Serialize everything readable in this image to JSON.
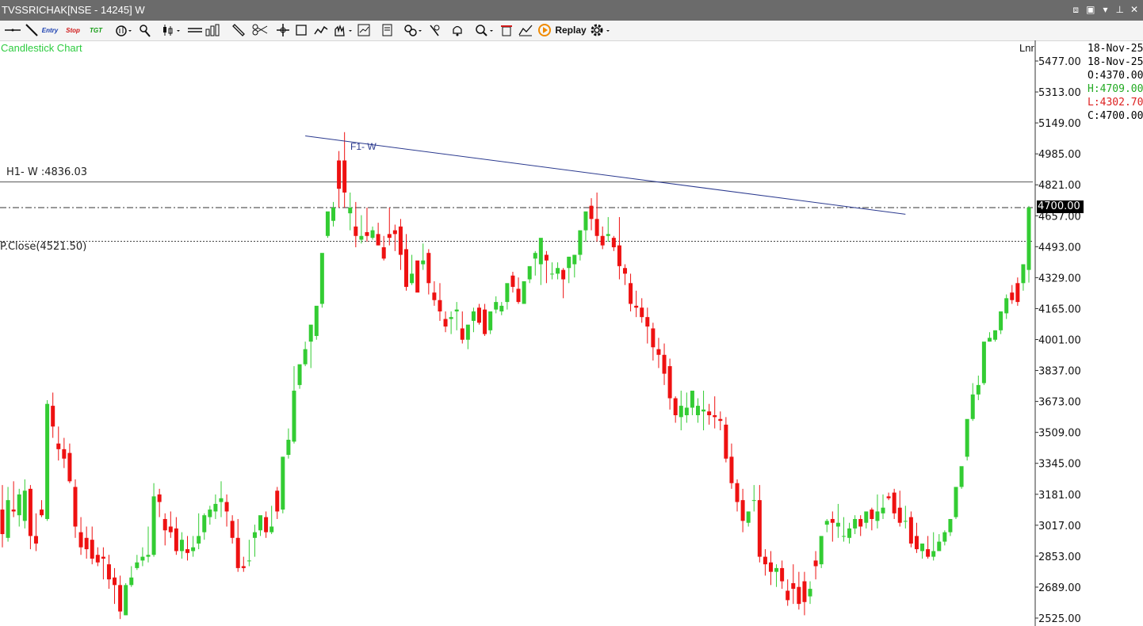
{
  "window": {
    "title": "TVSSRICHAK[NSE - 14245] W"
  },
  "toolbar": {
    "tools": [
      {
        "name": "horizontal-line-icon"
      },
      {
        "name": "trendline-icon"
      },
      {
        "name": "entry-label",
        "text": "Entry"
      },
      {
        "name": "stop-label",
        "text": "Stop"
      },
      {
        "name": "target-label",
        "text": "TGT"
      },
      {
        "name": "indicator-icon"
      },
      {
        "name": "pointer-icon"
      },
      {
        "name": "candle-type-icon"
      },
      {
        "name": "bar-type-icon"
      },
      {
        "name": "ruler-icon"
      },
      {
        "name": "scissors-icon"
      },
      {
        "name": "crosshair-icon"
      },
      {
        "name": "rectangle-icon"
      },
      {
        "name": "wave-icon"
      },
      {
        "name": "hand-icon"
      },
      {
        "name": "chart-settings-icon"
      },
      {
        "name": "template-icon"
      },
      {
        "name": "link-icon"
      },
      {
        "name": "magnet-icon"
      },
      {
        "name": "alert-bell-icon"
      },
      {
        "name": "zoom-icon"
      },
      {
        "name": "delete-icon"
      },
      {
        "name": "compare-chart-icon"
      }
    ],
    "replay_label": "Replay"
  },
  "chart_title": "Candlestick Chart",
  "scale_label": "Lnr",
  "legend": {
    "date1": "18-Nov-25",
    "date2": "18-Nov-25",
    "open": "O:4370.00",
    "high": "H:4709.00",
    "low": "L:4302.70",
    "close": "C:4700.00"
  },
  "annotations": {
    "h1_label": "H1- W :4836.03",
    "prev_close_label": "P.Close(4521.50)",
    "trendline_label": "F1- W",
    "last_price": "4700.00"
  },
  "colors": {
    "up": "#33cc33",
    "down": "#ee1111",
    "title_green": "#2ecc40",
    "trendline": "#2b3a8f",
    "high_green": "#22aa22",
    "low_red": "#dd2222"
  },
  "chart_data": {
    "type": "candlestick",
    "title": "Candlestick Chart",
    "y_ticks": [
      5477.0,
      5313.0,
      5149.0,
      4985.0,
      4821.0,
      4657.0,
      4493.0,
      4329.0,
      4165.0,
      4001.0,
      3837.0,
      3673.0,
      3509.0,
      3345.0,
      3181.0,
      3017.0,
      2853.0,
      2689.0,
      2525.0
    ],
    "y_tick_labels": [
      "5477.00",
      "5313.00",
      "5149.00",
      "4985.00",
      "4821.00",
      "4657.00",
      "4493.00",
      "4329.00",
      "4165.00",
      "4001.00",
      "3837.00",
      "3673.00",
      "3509.00",
      "3345.00",
      "3181.00",
      "3017.00",
      "2853.00",
      "2689.00",
      "2525.00"
    ],
    "ylim": [
      2500,
      5520
    ],
    "h1_level": 4836.03,
    "prev_close": 4521.5,
    "last_price": 4700.0,
    "trendline": {
      "from_index": 54,
      "from_value": 5080,
      "to_index": 161,
      "to_value": 4665
    },
    "candles": [
      [
        3100,
        3230,
        2970,
        2900
      ],
      [
        2950,
        3220,
        3150,
        2930
      ],
      [
        3100,
        3250,
        3090,
        3060
      ],
      [
        3070,
        3210,
        3180,
        3010
      ],
      [
        3040,
        3260,
        3200,
        3000
      ],
      [
        3210,
        3230,
        2960,
        2890
      ],
      [
        2960,
        3080,
        2920,
        2880
      ],
      [
        3100,
        3150,
        3070,
        3060
      ],
      [
        3050,
        3680,
        3660,
        3040
      ],
      [
        3650,
        3720,
        3540,
        3480
      ],
      [
        3450,
        3540,
        3420,
        3360
      ],
      [
        3420,
        3480,
        3370,
        3320
      ],
      [
        3400,
        3450,
        3250,
        3240
      ],
      [
        3220,
        3260,
        3010,
        2950
      ],
      [
        2980,
        3060,
        2900,
        2860
      ],
      [
        2950,
        3010,
        2890,
        2840
      ],
      [
        2940,
        3010,
        2840,
        2810
      ],
      [
        2860,
        2900,
        2820,
        2800
      ],
      [
        2850,
        2900,
        2840,
        2730
      ],
      [
        2810,
        2860,
        2730,
        2680
      ],
      [
        2740,
        2790,
        2700,
        2600
      ],
      [
        2700,
        2750,
        2560,
        2520
      ],
      [
        2540,
        2710,
        2700,
        2540
      ],
      [
        2700,
        2800,
        2740,
        2690
      ],
      [
        2790,
        2860,
        2820,
        2780
      ],
      [
        2830,
        2900,
        2850,
        2800
      ],
      [
        2850,
        3010,
        2860,
        2820
      ],
      [
        2860,
        3240,
        3170,
        2850
      ],
      [
        3180,
        3210,
        3140,
        3060
      ],
      [
        3050,
        3080,
        2990,
        2910
      ],
      [
        3010,
        3090,
        2980,
        2950
      ],
      [
        3000,
        3060,
        2880,
        2860
      ],
      [
        2880,
        2980,
        2940,
        2840
      ],
      [
        2890,
        2960,
        2870,
        2830
      ],
      [
        2880,
        2960,
        2900,
        2850
      ],
      [
        2920,
        3080,
        2960,
        2890
      ],
      [
        2980,
        3080,
        3070,
        2940
      ],
      [
        3060,
        3120,
        3100,
        3020
      ],
      [
        3090,
        3180,
        3130,
        3050
      ],
      [
        3140,
        3250,
        3160,
        3060
      ],
      [
        3140,
        3180,
        3090,
        3010
      ],
      [
        3040,
        3070,
        2950,
        2920
      ],
      [
        2950,
        3050,
        2790,
        2770
      ],
      [
        2800,
        2850,
        2790,
        2770
      ],
      [
        2830,
        2940,
        2830,
        2800
      ],
      [
        2950,
        3020,
        2980,
        2850
      ],
      [
        2990,
        3060,
        3070,
        2960
      ],
      [
        3060,
        3090,
        2980,
        2950
      ],
      [
        2980,
        3120,
        3010,
        2970
      ],
      [
        3200,
        3220,
        3090,
        3050
      ],
      [
        3100,
        3380,
        3380,
        3080
      ],
      [
        3390,
        3530,
        3470,
        3370
      ],
      [
        3460,
        3860,
        3730,
        3450
      ],
      [
        3760,
        3800,
        3870,
        3740
      ],
      [
        3870,
        3990,
        3950,
        3860
      ],
      [
        3990,
        4040,
        4080,
        3850
      ],
      [
        4020,
        4040,
        4180,
        4000
      ],
      [
        4190,
        4210,
        4460,
        4170
      ],
      [
        4550,
        4580,
        4680,
        4540
      ],
      [
        4630,
        4730,
        4700,
        4600
      ],
      [
        4950,
        5000,
        4800,
        4700
      ],
      [
        4950,
        5100,
        4780,
        4700
      ],
      [
        4670,
        4780,
        4700,
        4580
      ],
      [
        4600,
        4730,
        4550,
        4490
      ],
      [
        4530,
        4660,
        4550,
        4510
      ],
      [
        4570,
        4700,
        4550,
        4520
      ],
      [
        4540,
        4600,
        4580,
        4530
      ],
      [
        4560,
        4620,
        4500,
        4500
      ],
      [
        4490,
        4550,
        4430,
        4420
      ],
      [
        4560,
        4700,
        4540,
        4500
      ],
      [
        4580,
        4610,
        4560,
        4470
      ],
      [
        4600,
        4640,
        4450,
        4370
      ],
      [
        4480,
        4560,
        4280,
        4260
      ],
      [
        4300,
        4450,
        4350,
        4290
      ],
      [
        4420,
        4400,
        4250,
        4330
      ],
      [
        4400,
        4510,
        4420,
        4370
      ],
      [
        4460,
        4480,
        4300,
        4240
      ],
      [
        4250,
        4310,
        4210,
        4180
      ],
      [
        4210,
        4300,
        4150,
        4100
      ],
      [
        4110,
        4150,
        4070,
        4040
      ],
      [
        4110,
        4150,
        4120,
        4030
      ],
      [
        4150,
        4200,
        4160,
        4050
      ],
      [
        4060,
        4150,
        4000,
        3980
      ],
      [
        4000,
        4050,
        4080,
        3950
      ],
      [
        4100,
        4170,
        4150,
        4040
      ],
      [
        4170,
        4190,
        4090,
        4080
      ],
      [
        4160,
        4190,
        4030,
        4020
      ],
      [
        4050,
        4100,
        4150,
        4030
      ],
      [
        4160,
        4230,
        4200,
        4140
      ],
      [
        4150,
        4200,
        4180,
        4130
      ],
      [
        4200,
        4250,
        4300,
        4160
      ],
      [
        4340,
        4360,
        4280,
        4250
      ],
      [
        4270,
        4330,
        4200,
        4190
      ],
      [
        4190,
        4210,
        4310,
        4190
      ],
      [
        4320,
        4350,
        4390,
        4300
      ],
      [
        4430,
        4470,
        4460,
        4340
      ],
      [
        4400,
        4480,
        4540,
        4290
      ],
      [
        4450,
        4470,
        4420,
        4300
      ],
      [
        4350,
        4410,
        4350,
        4320
      ],
      [
        4350,
        4410,
        4380,
        4320
      ],
      [
        4370,
        4380,
        4320,
        4220
      ],
      [
        4380,
        4440,
        4440,
        4300
      ],
      [
        4400,
        4450,
        4450,
        4330
      ],
      [
        4450,
        4450,
        4580,
        4420
      ],
      [
        4580,
        4610,
        4680,
        4520
      ],
      [
        4710,
        4750,
        4640,
        4580
      ],
      [
        4640,
        4780,
        4550,
        4520
      ],
      [
        4550,
        4600,
        4500,
        4480
      ],
      [
        4550,
        4650,
        4560,
        4520
      ],
      [
        4540,
        4550,
        4490,
        4470
      ],
      [
        4500,
        4650,
        4390,
        4320
      ],
      [
        4380,
        4400,
        4350,
        4290
      ],
      [
        4300,
        4350,
        4190,
        4150
      ],
      [
        4180,
        4260,
        4170,
        4120
      ],
      [
        4170,
        4220,
        4120,
        4090
      ],
      [
        4120,
        4170,
        4070,
        3980
      ],
      [
        4060,
        4090,
        3960,
        3890
      ],
      [
        3950,
        4010,
        3920,
        3850
      ],
      [
        3920,
        3980,
        3820,
        3760
      ],
      [
        3860,
        3900,
        3690,
        3630
      ],
      [
        3690,
        3700,
        3600,
        3560
      ],
      [
        3590,
        3730,
        3650,
        3520
      ],
      [
        3600,
        3720,
        3640,
        3560
      ],
      [
        3640,
        3720,
        3730,
        3600
      ],
      [
        3600,
        3690,
        3650,
        3560
      ],
      [
        3620,
        3730,
        3630,
        3520
      ],
      [
        3620,
        3660,
        3600,
        3550
      ],
      [
        3600,
        3700,
        3590,
        3530
      ],
      [
        3580,
        3620,
        3570,
        3520
      ],
      [
        3550,
        3590,
        3370,
        3350
      ],
      [
        3380,
        3450,
        3240,
        3210
      ],
      [
        3240,
        3260,
        3140,
        3090
      ],
      [
        3150,
        3210,
        3040,
        2980
      ],
      [
        3030,
        3090,
        3090,
        3010
      ],
      [
        3150,
        3230,
        3150,
        3090
      ],
      [
        3150,
        3230,
        2850,
        2820
      ],
      [
        2850,
        2890,
        2810,
        2750
      ],
      [
        2820,
        2880,
        2770,
        2700
      ],
      [
        2770,
        2810,
        2790,
        2690
      ],
      [
        2790,
        2830,
        2720,
        2680
      ],
      [
        2670,
        2730,
        2620,
        2590
      ],
      [
        2710,
        2810,
        2680,
        2600
      ],
      [
        2690,
        2770,
        2600,
        2570
      ],
      [
        2720,
        2770,
        2610,
        2540
      ],
      [
        2640,
        2720,
        2680,
        2600
      ],
      [
        2830,
        2880,
        2800,
        2730
      ],
      [
        2810,
        2900,
        2960,
        2790
      ],
      [
        3020,
        3050,
        3040,
        2980
      ],
      [
        3050,
        3090,
        3030,
        2930
      ],
      [
        3010,
        3130,
        3030,
        2950
      ],
      [
        2960,
        3060,
        2960,
        2930
      ],
      [
        2950,
        3030,
        3000,
        2920
      ],
      [
        3000,
        3070,
        3050,
        2970
      ],
      [
        3050,
        3070,
        3010,
        2960
      ],
      [
        3030,
        3090,
        3090,
        3000
      ],
      [
        3100,
        3110,
        3050,
        2990
      ],
      [
        3040,
        3180,
        3090,
        3000
      ],
      [
        3080,
        3180,
        3110,
        3050
      ],
      [
        3170,
        3190,
        3160,
        3150
      ],
      [
        3190,
        3210,
        3080,
        3050
      ],
      [
        3110,
        3200,
        3030,
        3010
      ],
      [
        3040,
        3120,
        3040,
        3000
      ],
      [
        3060,
        3090,
        2920,
        2900
      ],
      [
        2960,
        3030,
        2890,
        2870
      ],
      [
        2880,
        2910,
        2920,
        2840
      ],
      [
        2890,
        2960,
        2850,
        2840
      ],
      [
        2850,
        2980,
        2880,
        2830
      ],
      [
        2880,
        2970,
        2930,
        2880
      ],
      [
        2930,
        2990,
        2980,
        2910
      ],
      [
        2980,
        3050,
        3050,
        2960
      ],
      [
        3060,
        3080,
        3220,
        3050
      ],
      [
        3220,
        3240,
        3330,
        3210
      ],
      [
        3380,
        3440,
        3580,
        3360
      ],
      [
        3580,
        3770,
        3710,
        3570
      ],
      [
        3710,
        3810,
        3760,
        3680
      ],
      [
        3770,
        3910,
        3990,
        3760
      ],
      [
        3990,
        4040,
        4010,
        3990
      ],
      [
        4000,
        4050,
        4050,
        3990
      ],
      [
        4050,
        4060,
        4150,
        4030
      ],
      [
        4140,
        4240,
        4220,
        4110
      ],
      [
        4250,
        4290,
        4210,
        4190
      ],
      [
        4300,
        4330,
        4200,
        4180
      ],
      [
        4300,
        4340,
        4400,
        4260
      ],
      [
        4370,
        4709,
        4700,
        4302.7
      ]
    ]
  }
}
